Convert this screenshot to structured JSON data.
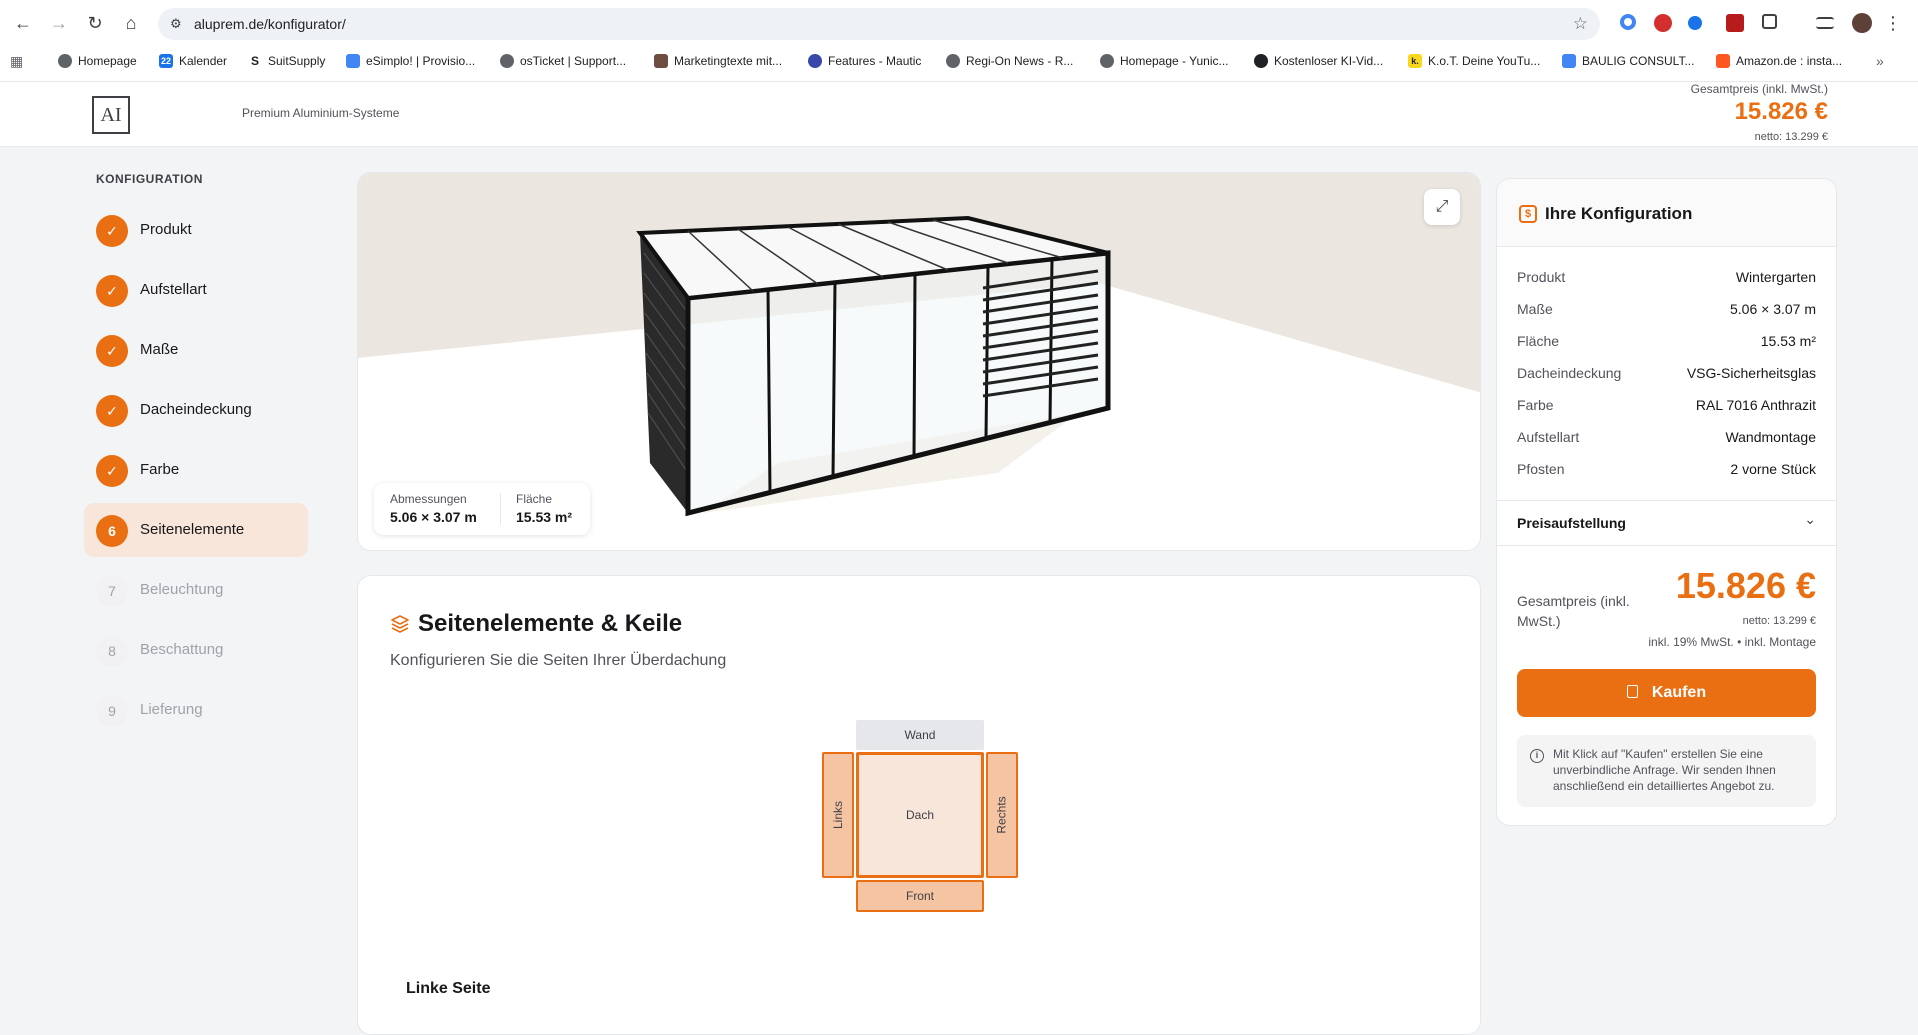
{
  "browser": {
    "url": "aluprem.de/konfigurator/",
    "bookmarks": [
      {
        "label": "Homepage",
        "color": "#5f6368"
      },
      {
        "label": "Kalender",
        "color": "#1a73e8",
        "badge": "22"
      },
      {
        "label": "SuitSupply",
        "color": "#202124",
        "badge": "S"
      },
      {
        "label": "eSimplo! | Provisio...",
        "color": "#4285f4"
      },
      {
        "label": "osTicket | Support...",
        "color": "#5f6368"
      },
      {
        "label": "Marketingtexte mit...",
        "color": "#6d4c41"
      },
      {
        "label": "Features - Mautic",
        "color": "#3949ab"
      },
      {
        "label": "Regi-On News - R...",
        "color": "#5f6368"
      },
      {
        "label": "Homepage - Yunic...",
        "color": "#5f6368"
      },
      {
        "label": "Kostenloser KI-Vid...",
        "color": "#202124"
      },
      {
        "label": "K.o.T. Deine YouTu...",
        "color": "#f9d71c",
        "badge": "k."
      },
      {
        "label": "BAULIG CONSULT...",
        "color": "#4285f4"
      },
      {
        "label": "Amazon.de : insta...",
        "color": "#ff5722"
      }
    ]
  },
  "header": {
    "logo": "AI",
    "tagline": "Premium Aluminium-Systeme",
    "price_label": "Gesamtpreis (inkl. MwSt.)",
    "price": "15.826 €",
    "netto": "netto: 13.299 €"
  },
  "steps": {
    "title": "KONFIGURATION",
    "items": [
      {
        "num": "✓",
        "label": "Produkt",
        "state": "done"
      },
      {
        "num": "✓",
        "label": "Aufstellart",
        "state": "done"
      },
      {
        "num": "✓",
        "label": "Maße",
        "state": "done"
      },
      {
        "num": "✓",
        "label": "Dacheindeckung",
        "state": "done"
      },
      {
        "num": "✓",
        "label": "Farbe",
        "state": "done"
      },
      {
        "num": "6",
        "label": "Seitenelemente",
        "state": "current"
      },
      {
        "num": "7",
        "label": "Beleuchtung",
        "state": "todo"
      },
      {
        "num": "8",
        "label": "Beschattung",
        "state": "todo"
      },
      {
        "num": "9",
        "label": "Lieferung",
        "state": "todo"
      }
    ]
  },
  "viewer": {
    "dims_label": "Abmessungen",
    "dims_value": "5.06 × 3.07 m",
    "area_label": "Fläche",
    "area_value": "15.53 m²"
  },
  "panel": {
    "title": "Seitenelemente & Keile",
    "subtitle": "Konfigurieren Sie die Seiten Ihrer Überdachung",
    "diagram": {
      "wand": "Wand",
      "links": "Links",
      "dach": "Dach",
      "rechts": "Rechts",
      "front": "Front"
    },
    "section": "Linke Seite"
  },
  "summary": {
    "title": "Ihre Konfiguration",
    "rows": [
      {
        "k": "Produkt",
        "v": "Wintergarten"
      },
      {
        "k": "Maße",
        "v": "5.06 × 3.07 m"
      },
      {
        "k": "Fläche",
        "v": "15.53 m²"
      },
      {
        "k": "Dacheindeckung",
        "v": "VSG-Sicherheitsglas"
      },
      {
        "k": "Farbe",
        "v": "RAL 7016 Anthrazit"
      },
      {
        "k": "Aufstellart",
        "v": "Wandmontage"
      },
      {
        "k": "Pfosten",
        "v": "2 vorne Stück"
      }
    ],
    "breakdown_label": "Preisaufstellung",
    "total_label": "Gesamtpreis (inkl. MwSt.)",
    "total_price": "15.826 €",
    "total_netto": "netto: 13.299 €",
    "total_incl": "inkl. 19% MwSt. • inkl. Montage",
    "buy_label": "Kaufen",
    "info_text": "Mit Klick auf \"Kaufen\" erstellen Sie eine unverbindliche Anfrage. Wir senden Ihnen anschließend ein detailliertes Angebot zu."
  },
  "colors": {
    "accent": "#ea6f12",
    "accent_light": "#f8e6da"
  }
}
